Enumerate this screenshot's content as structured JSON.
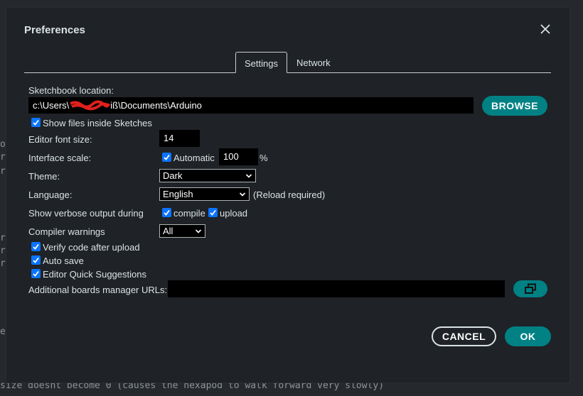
{
  "background": {
    "code_line": "size doesnt become 0 (causes the hexapod to walk forward very slowly)",
    "side_chars": [
      "o",
      "r",
      "r",
      "r",
      "r",
      "r",
      "e"
    ]
  },
  "dialog": {
    "title": "Preferences",
    "close_icon": "close-icon"
  },
  "tabs": [
    {
      "label": "Settings",
      "active": true
    },
    {
      "label": "Network",
      "active": false
    }
  ],
  "settings": {
    "sketchbook_label": "Sketchbook location:",
    "sketchbook_value_prefix": "c:\\Users\\",
    "sketchbook_value_suffix": "iß\\Documents\\Arduino",
    "browse_label": "BROWSE",
    "show_files_label": "Show files inside Sketches",
    "show_files_checked": true,
    "font_size_label": "Editor font size:",
    "font_size_value": "14",
    "interface_scale_label": "Interface scale:",
    "automatic_label": "Automatic",
    "automatic_checked": true,
    "scale_value": "100",
    "scale_unit": "%",
    "theme_label": "Theme:",
    "theme_value": "Dark",
    "language_label": "Language:",
    "language_value": "English",
    "reload_note": "(Reload required)",
    "verbose_label": "Show verbose output during",
    "compile_label": "compile",
    "compile_checked": true,
    "upload_label": "upload",
    "upload_checked": true,
    "warnings_label": "Compiler warnings",
    "warnings_value": "All",
    "verify_label": "Verify code after upload",
    "verify_checked": true,
    "autosave_label": "Auto save",
    "autosave_checked": true,
    "quick_suggestions_label": "Editor Quick Suggestions",
    "quick_suggestions_checked": true,
    "boards_urls_label": "Additional boards manager URLs:",
    "boards_urls_value": "",
    "open_urls_icon": "window-restore-icon"
  },
  "footer": {
    "cancel_label": "CANCEL",
    "ok_label": "OK"
  },
  "colors": {
    "accent": "#008184",
    "checkbox": "#0b74ff",
    "dialog_bg": "#1f2226"
  }
}
